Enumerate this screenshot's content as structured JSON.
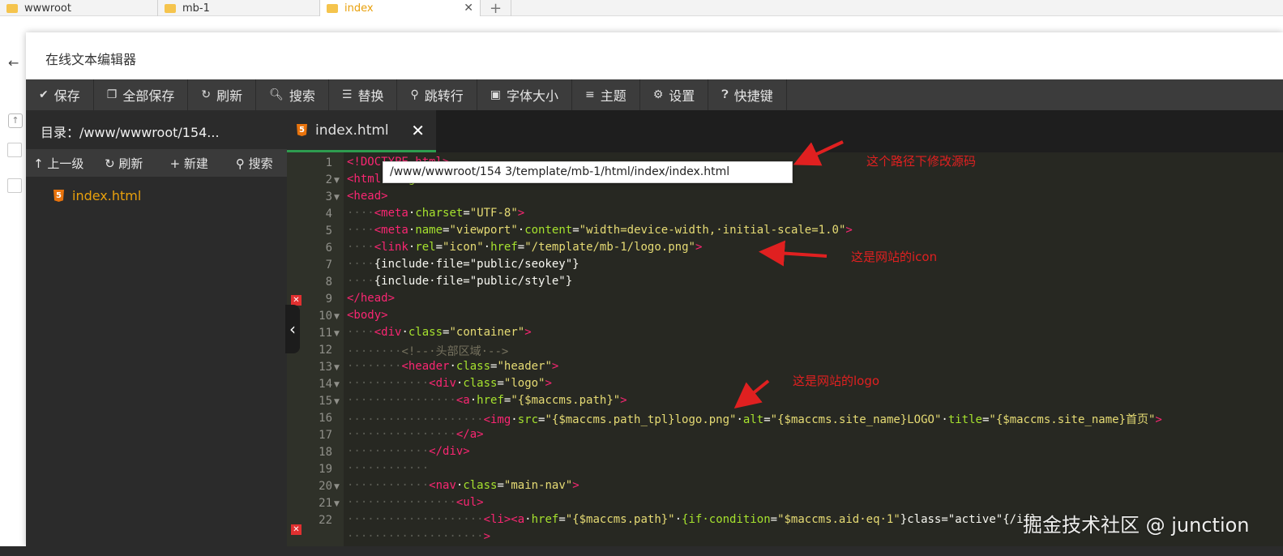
{
  "browser_tabs": [
    {
      "label": "wwwroot",
      "active": false
    },
    {
      "label": "mb-1",
      "active": false
    },
    {
      "label": "index",
      "active": true
    }
  ],
  "new_tab_label": "+",
  "dialog": {
    "title": "在线文本编辑器"
  },
  "toolbar": {
    "items": [
      {
        "icon": "check-icon",
        "label": "保存"
      },
      {
        "icon": "copy-icon",
        "label": "全部保存"
      },
      {
        "icon": "refresh-icon",
        "label": "刷新"
      },
      {
        "icon": "search-icon",
        "label": "搜索"
      },
      {
        "icon": "replace-icon",
        "label": "替换"
      },
      {
        "icon": "goto-line-icon",
        "label": "跳转行"
      },
      {
        "icon": "font-size-icon",
        "label": "字体大小"
      },
      {
        "icon": "menu-icon",
        "label": "主题"
      },
      {
        "icon": "gear-icon",
        "label": "设置"
      },
      {
        "icon": "help-icon",
        "label": "快捷键"
      }
    ]
  },
  "sidebar": {
    "directory": "目录：/www/wwwroot/154...",
    "actions": [
      {
        "icon": "arrow-up-icon",
        "label": "上一级"
      },
      {
        "icon": "refresh-icon",
        "label": "刷新"
      },
      {
        "icon": "plus-icon",
        "label": "新建"
      },
      {
        "icon": "search-icon",
        "label": "搜索"
      }
    ],
    "files": [
      {
        "name": "index.html"
      }
    ]
  },
  "editor": {
    "tab_label": "index.html",
    "line_numbers": [
      "1",
      "2",
      "3",
      "4",
      "5",
      "6",
      "7",
      "8",
      "9",
      "10",
      "11",
      "12",
      "13",
      "14",
      "15",
      "16",
      "17",
      "18",
      "19",
      "20",
      "21",
      "22"
    ],
    "tooltip": "/www/wwwroot/154          3/template/mb-1/html/index/index.html"
  },
  "annotations": {
    "path_note": "这个路径下修改源码",
    "icon_note": "这是网站的icon",
    "logo_note": "这是网站的logo"
  },
  "watermark": "掘金技术社区 @ junction"
}
